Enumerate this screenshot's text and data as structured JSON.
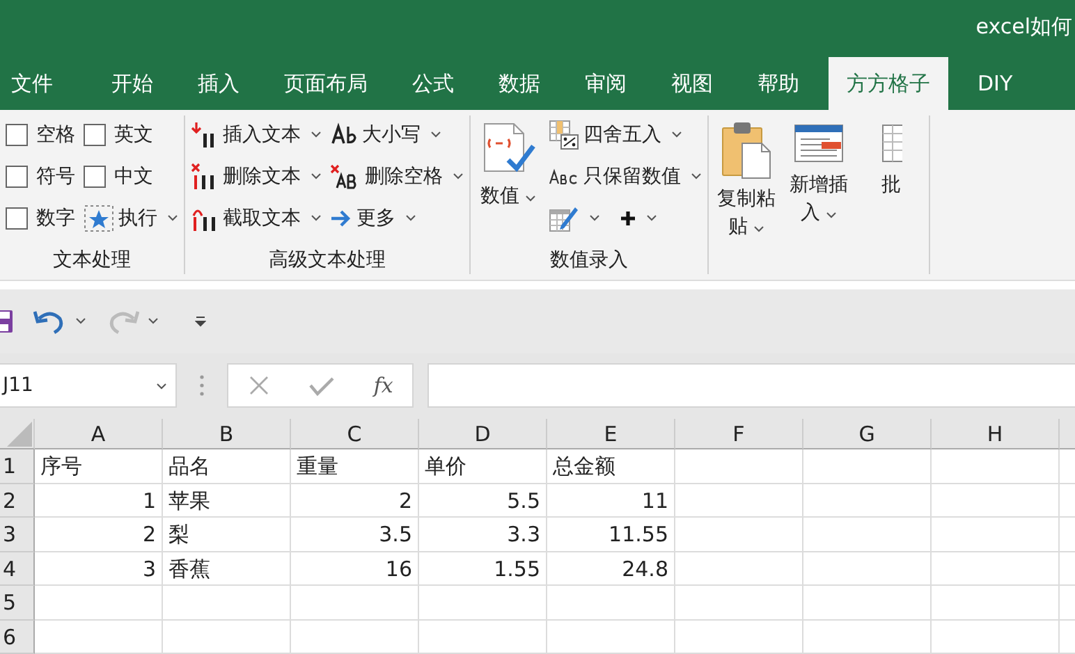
{
  "window": {
    "title": "excel如何"
  },
  "tabs": [
    {
      "label": "文件",
      "selected": false
    },
    {
      "label": "开始",
      "selected": false
    },
    {
      "label": "插入",
      "selected": false
    },
    {
      "label": "页面布局",
      "selected": false
    },
    {
      "label": "公式",
      "selected": false
    },
    {
      "label": "数据",
      "selected": false
    },
    {
      "label": "审阅",
      "selected": false
    },
    {
      "label": "视图",
      "selected": false
    },
    {
      "label": "帮助",
      "selected": false
    },
    {
      "label": "方方格子",
      "selected": true
    },
    {
      "label": "DIY",
      "selected": false
    }
  ],
  "ribbon": {
    "groups": [
      {
        "label": "文本处理",
        "columns": [
          [
            {
              "kind": "checkbox",
              "label": "空格",
              "checked": false
            },
            {
              "kind": "checkbox",
              "label": "符号",
              "checked": false
            },
            {
              "kind": "checkbox",
              "label": "数字",
              "checked": false
            }
          ],
          [
            {
              "kind": "checkbox",
              "label": "英文",
              "checked": false
            },
            {
              "kind": "checkbox",
              "label": "中文",
              "checked": false
            },
            {
              "kind": "button",
              "label": "执行",
              "dropdown": true
            }
          ]
        ]
      },
      {
        "label": "高级文本处理",
        "columns": [
          [
            {
              "kind": "button",
              "label": "插入文本",
              "dropdown": true
            },
            {
              "kind": "button",
              "label": "删除文本",
              "dropdown": true
            },
            {
              "kind": "button",
              "label": "截取文本",
              "dropdown": true
            }
          ],
          [
            {
              "kind": "button",
              "label": "大小写",
              "dropdown": true
            },
            {
              "kind": "button",
              "label": "删除空格",
              "dropdown": true
            },
            {
              "kind": "button",
              "label": "更多",
              "dropdown": true
            }
          ]
        ]
      },
      {
        "label": "数值录入",
        "columns": [
          [
            {
              "kind": "large",
              "label": "数值",
              "dropdown": true
            }
          ],
          [
            {
              "kind": "button",
              "label": "四舍五入",
              "dropdown": true
            },
            {
              "kind": "button",
              "label": "只保留数值",
              "dropdown": true
            },
            {
              "kind": "pair",
              "items": [
                {
                  "kind": "button",
                  "dropdown": true
                },
                {
                  "kind": "button",
                  "dropdown": true
                }
              ]
            }
          ]
        ]
      },
      {
        "columns": [
          [
            {
              "kind": "large",
              "label": "复制粘贴",
              "dropdown": true
            }
          ],
          [
            {
              "kind": "large",
              "label": "新增插入",
              "dropdown": true
            }
          ],
          [
            {
              "kind": "large",
              "label": "批"
            }
          ]
        ]
      }
    ]
  },
  "quick_access": [
    {
      "kind": "save"
    },
    {
      "kind": "undo",
      "disabled": false
    },
    {
      "kind": "redo",
      "disabled": true
    },
    {
      "kind": "customize"
    }
  ],
  "formula_bar": {
    "name_box": "J11",
    "function_label": "fx"
  },
  "sheet": {
    "columns": [
      "A",
      "B",
      "C",
      "D",
      "E",
      "F",
      "G",
      "H"
    ],
    "rows": [
      {
        "header": "1",
        "cells": [
          {
            "text": "序号",
            "kind": "text"
          },
          {
            "text": "品名",
            "kind": "text"
          },
          {
            "text": "重量",
            "kind": "text"
          },
          {
            "text": "单价",
            "kind": "text"
          },
          {
            "text": "总金额",
            "kind": "text"
          }
        ]
      },
      {
        "header": "2",
        "cells": [
          {
            "text": "1",
            "kind": "number"
          },
          {
            "text": "苹果",
            "kind": "text"
          },
          {
            "text": "2",
            "kind": "number"
          },
          {
            "text": "5.5",
            "kind": "number"
          },
          {
            "text": "11",
            "kind": "number"
          }
        ]
      },
      {
        "header": "3",
        "cells": [
          {
            "text": "2",
            "kind": "number"
          },
          {
            "text": "梨",
            "kind": "text"
          },
          {
            "text": "3.5",
            "kind": "number"
          },
          {
            "text": "3.3",
            "kind": "number"
          },
          {
            "text": "11.55",
            "kind": "number"
          }
        ]
      },
      {
        "header": "4",
        "cells": [
          {
            "text": "3",
            "kind": "number"
          },
          {
            "text": "香蕉",
            "kind": "text"
          },
          {
            "text": "16",
            "kind": "number"
          },
          {
            "text": "1.55",
            "kind": "number"
          },
          {
            "text": "24.8",
            "kind": "number"
          }
        ]
      },
      {
        "header": "5"
      },
      {
        "header": "6"
      }
    ]
  }
}
